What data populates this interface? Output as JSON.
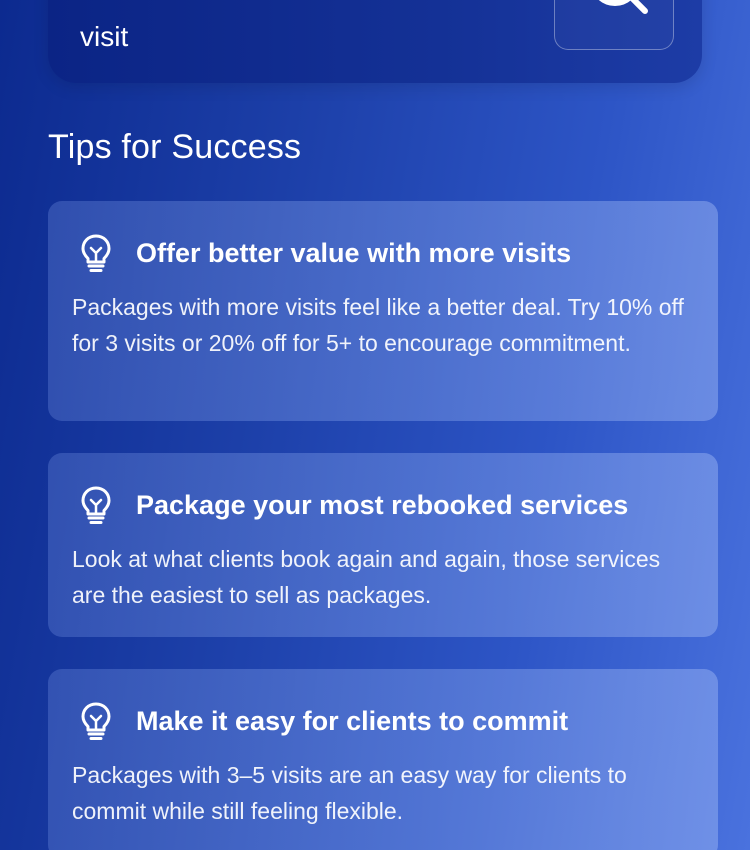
{
  "top_card": {
    "text_partial": "visit",
    "search_icon": "search-icon"
  },
  "section": {
    "title": "Tips for Success"
  },
  "tips": [
    {
      "icon": "lightbulb-icon",
      "title": "Offer better value with more visits",
      "body": "Packages with more visits feel like a better deal. Try 10% off for 3 visits or 20% off for 5+ to encourage commitment."
    },
    {
      "icon": "lightbulb-icon",
      "title": "Package your most rebooked services",
      "body": "Look at what clients book again and again, those services are the easiest to sell as packages."
    },
    {
      "icon": "lightbulb-icon",
      "title": "Make it easy for clients to commit",
      "body": "Packages with 3–5 visits are an easy way for clients to commit while still feeling flexible."
    }
  ]
}
